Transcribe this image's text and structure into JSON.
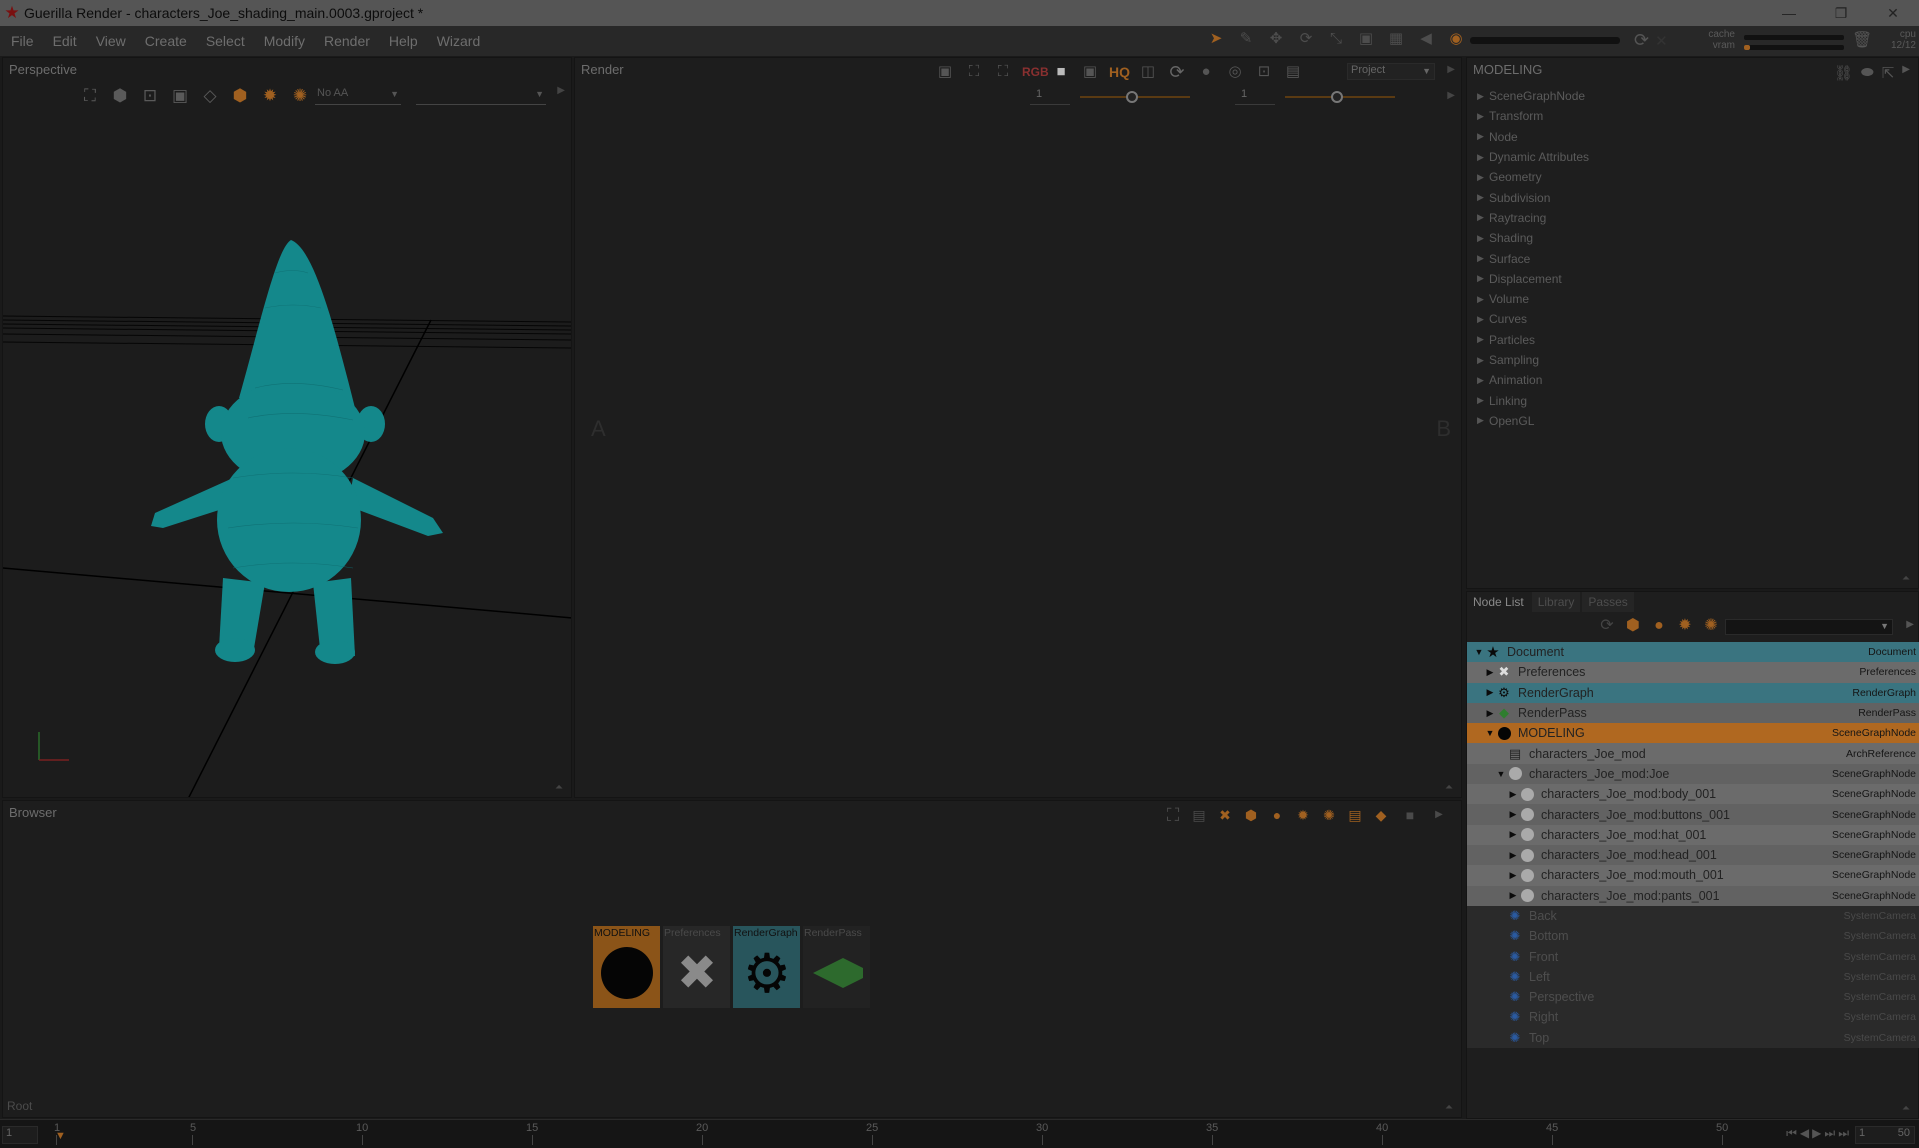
{
  "window": {
    "title": "Guerilla Render - characters_Joe_shading_main.0003.gproject *",
    "controls": [
      "—",
      "❐",
      "✕"
    ]
  },
  "menu": [
    "File",
    "Edit",
    "View",
    "Create",
    "Select",
    "Modify",
    "Render",
    "Help",
    "Wizard"
  ],
  "status": {
    "cache_label": "cache",
    "vram_label": "vram",
    "cpu_label": "cpu",
    "cpu_value": "12/12"
  },
  "perspective": {
    "title": "Perspective",
    "aa_select": "No AA",
    "view_select": ""
  },
  "render_view": {
    "title": "Render",
    "hq_label": "HQ",
    "rgb_label": "RGB",
    "project_select": "Project",
    "left_slider_value": "1",
    "right_slider_value": "1",
    "side_a": "A",
    "side_b": "B"
  },
  "attributes": {
    "title": "MODELING",
    "sections": [
      "SceneGraphNode",
      "Transform",
      "Node",
      "Dynamic Attributes",
      "Geometry",
      "Subdivision",
      "Raytracing",
      "Shading",
      "Surface",
      "Displacement",
      "Volume",
      "Curves",
      "Particles",
      "Sampling",
      "Animation",
      "Linking",
      "OpenGL"
    ]
  },
  "node_list": {
    "tabs": [
      "Node List",
      "Library",
      "Passes"
    ],
    "rows": [
      {
        "label": "Document",
        "type": "Document"
      },
      {
        "label": "Preferences",
        "type": "Preferences"
      },
      {
        "label": "RenderGraph",
        "type": "RenderGraph"
      },
      {
        "label": "RenderPass",
        "type": "RenderPass"
      },
      {
        "label": "MODELING",
        "type": "SceneGraphNode"
      },
      {
        "label": "characters_Joe_mod",
        "type": "ArchReference"
      },
      {
        "label": "characters_Joe_mod:Joe",
        "type": "SceneGraphNode"
      },
      {
        "label": "characters_Joe_mod:body_001",
        "type": "SceneGraphNode"
      },
      {
        "label": "characters_Joe_mod:buttons_001",
        "type": "SceneGraphNode"
      },
      {
        "label": "characters_Joe_mod:hat_001",
        "type": "SceneGraphNode"
      },
      {
        "label": "characters_Joe_mod:head_001",
        "type": "SceneGraphNode"
      },
      {
        "label": "characters_Joe_mod:mouth_001",
        "type": "SceneGraphNode"
      },
      {
        "label": "characters_Joe_mod:pants_001",
        "type": "SceneGraphNode"
      },
      {
        "label": "Back",
        "type": "SystemCamera"
      },
      {
        "label": "Bottom",
        "type": "SystemCamera"
      },
      {
        "label": "Front",
        "type": "SystemCamera"
      },
      {
        "label": "Left",
        "type": "SystemCamera"
      },
      {
        "label": "Perspective",
        "type": "SystemCamera"
      },
      {
        "label": "Right",
        "type": "SystemCamera"
      },
      {
        "label": "Top",
        "type": "SystemCamera"
      }
    ]
  },
  "browser": {
    "title": "Browser",
    "thumbnails": [
      "MODELING",
      "Preferences",
      "RenderGraph",
      "RenderPass"
    ],
    "root_label": "Root"
  },
  "timeline": {
    "start_frame": "1",
    "frames": [
      "1",
      "5",
      "10",
      "15",
      "20",
      "25",
      "30",
      "35",
      "40",
      "45",
      "50"
    ],
    "end_start": "1",
    "end_frame": "50"
  },
  "colors": {
    "accent_orange": "#b06820",
    "accent_teal": "#3a7480",
    "model_teal": "#1a8a8c"
  }
}
